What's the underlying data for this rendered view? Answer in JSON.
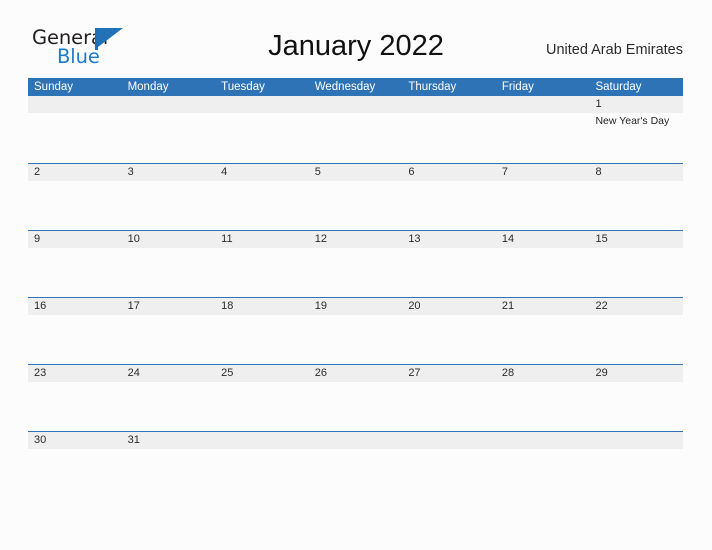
{
  "logo": {
    "word_top": "General",
    "word_bottom": "Blue",
    "accent_color": "#2272b8",
    "flag_icon": "triangle-flag-icon"
  },
  "header": {
    "title": "January 2022",
    "country": "United Arab Emirates"
  },
  "colors": {
    "header_blue": "#2e73b6",
    "row_band_gray": "#efefef",
    "page_background": "#fcfcfd",
    "text": "#2b2b2b"
  },
  "calendar": {
    "month": "January",
    "year": "2022",
    "weekday_headers": [
      "Sunday",
      "Monday",
      "Tuesday",
      "Wednesday",
      "Thursday",
      "Friday",
      "Saturday"
    ],
    "weeks": [
      [
        {
          "date": ""
        },
        {
          "date": ""
        },
        {
          "date": ""
        },
        {
          "date": ""
        },
        {
          "date": ""
        },
        {
          "date": ""
        },
        {
          "date": "1",
          "events": [
            "New Year's Day"
          ]
        }
      ],
      [
        {
          "date": "2"
        },
        {
          "date": "3"
        },
        {
          "date": "4"
        },
        {
          "date": "5"
        },
        {
          "date": "6"
        },
        {
          "date": "7"
        },
        {
          "date": "8"
        }
      ],
      [
        {
          "date": "9"
        },
        {
          "date": "10"
        },
        {
          "date": "11"
        },
        {
          "date": "12"
        },
        {
          "date": "13"
        },
        {
          "date": "14"
        },
        {
          "date": "15"
        }
      ],
      [
        {
          "date": "16"
        },
        {
          "date": "17"
        },
        {
          "date": "18"
        },
        {
          "date": "19"
        },
        {
          "date": "20"
        },
        {
          "date": "21"
        },
        {
          "date": "22"
        }
      ],
      [
        {
          "date": "23"
        },
        {
          "date": "24"
        },
        {
          "date": "25"
        },
        {
          "date": "26"
        },
        {
          "date": "27"
        },
        {
          "date": "28"
        },
        {
          "date": "29"
        }
      ],
      [
        {
          "date": "30"
        },
        {
          "date": "31"
        },
        {
          "date": ""
        },
        {
          "date": ""
        },
        {
          "date": ""
        },
        {
          "date": ""
        },
        {
          "date": ""
        }
      ]
    ]
  }
}
